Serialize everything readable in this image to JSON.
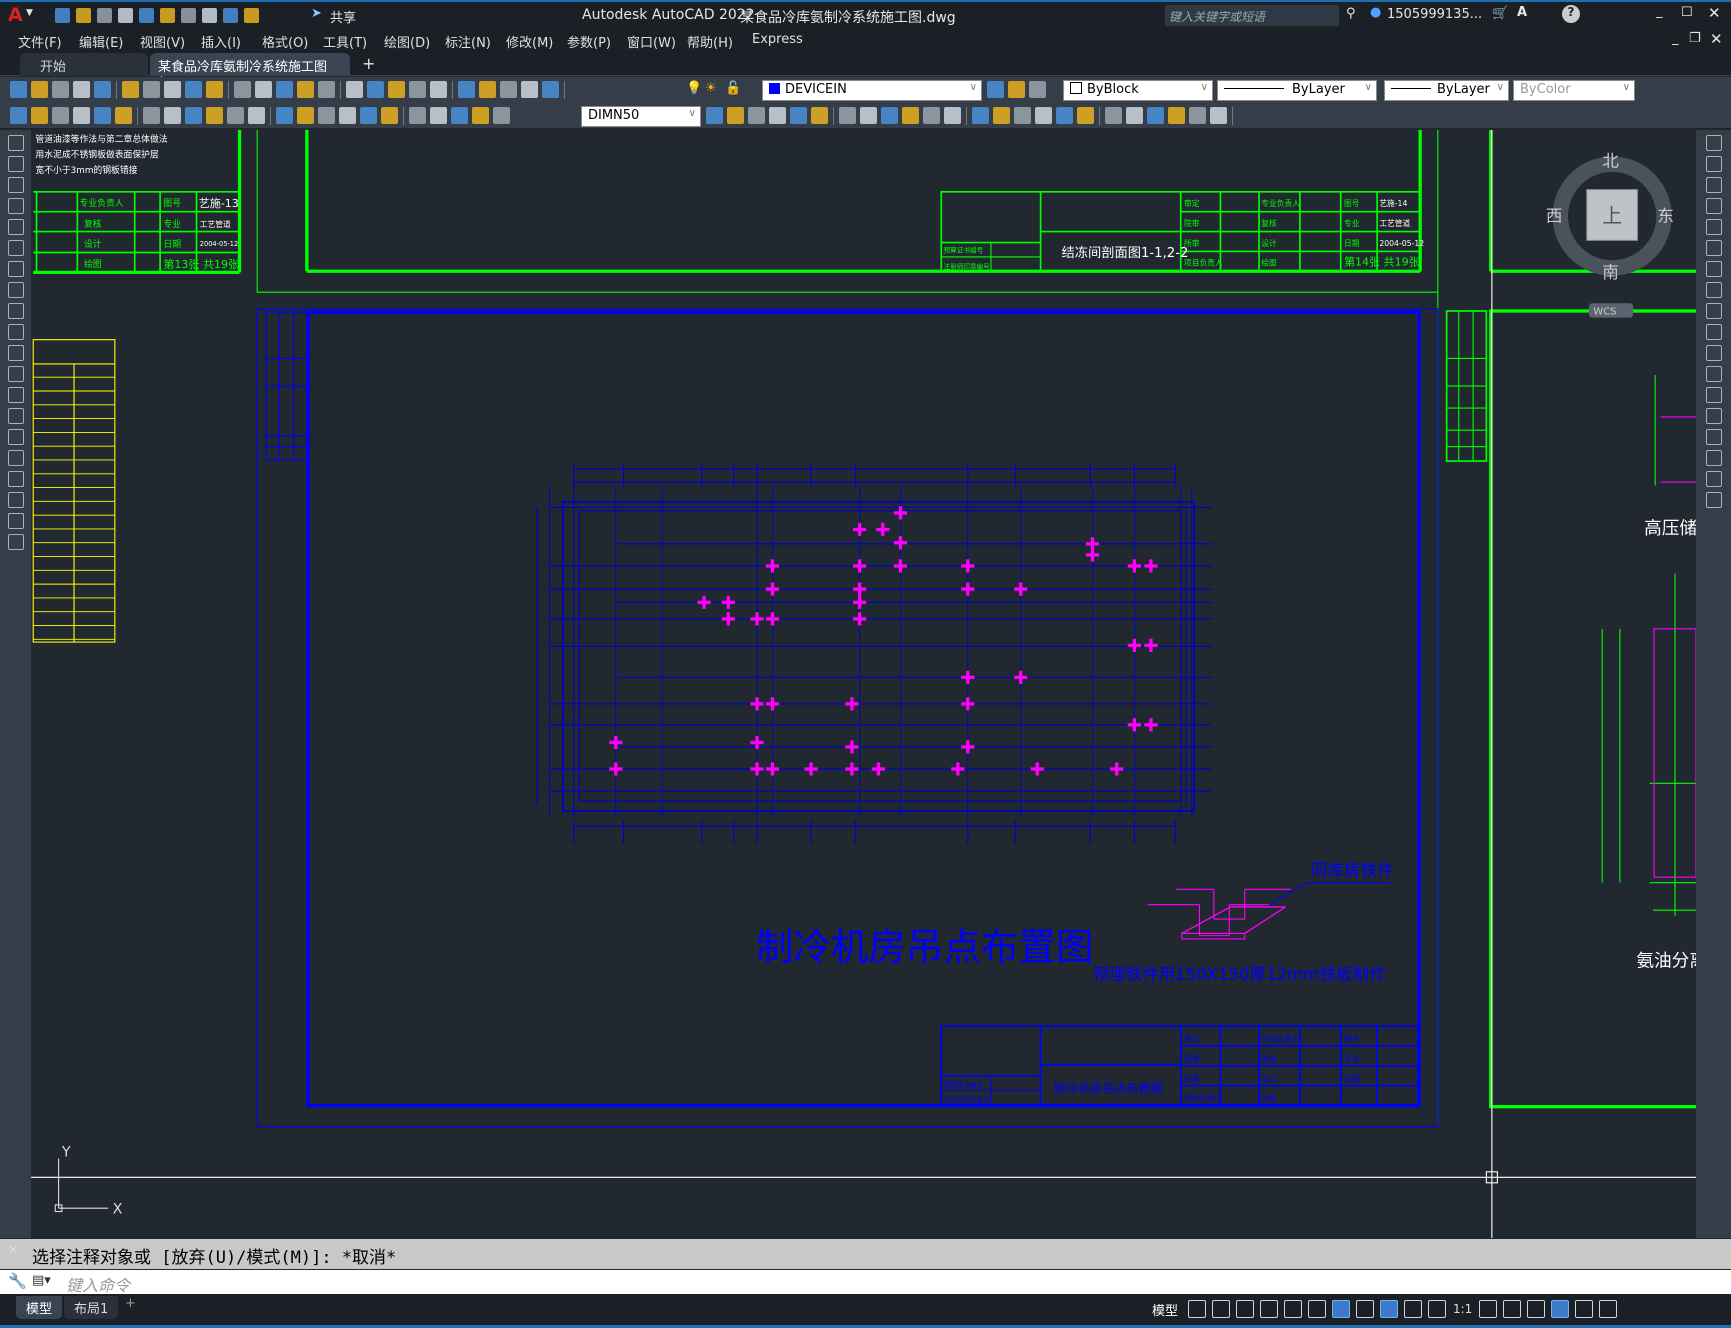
{
  "app": {
    "title": "Autodesk AutoCAD 2022",
    "file": "某食品冷库氨制冷系统施工图.dwg",
    "share": "共享",
    "search_placeholder": "键入关键字或短语",
    "user": "1505999135...",
    "logo": "A"
  },
  "menu": [
    "文件(F)",
    "编辑(E)",
    "视图(V)",
    "插入(I)",
    "格式(O)",
    "工具(T)",
    "绘图(D)",
    "标注(N)",
    "修改(M)",
    "参数(P)",
    "窗口(W)",
    "帮助(H)",
    "Express"
  ],
  "tabs": [
    {
      "label": "开始"
    },
    {
      "label": "某食品冷库氨制冷系统施工图*"
    }
  ],
  "toolbar1": {
    "icons": [
      "new-icon",
      "open-icon",
      "save-icon",
      "print-icon",
      "preview-icon",
      "plot-icon",
      "publish-icon",
      "cut-icon",
      "copy-icon",
      "paste-icon",
      "matchprop-icon",
      "block-icon",
      "undo-icon",
      "redo-icon",
      "pan-icon",
      "zoom-realtime-icon",
      "zoom-window-icon",
      "zoom-previous-icon",
      "properties-icon",
      "design-center-icon",
      "tool-palette-icon",
      "sheetset-icon",
      "markup-icon",
      "calculator-icon",
      "help-icon",
      "layer-icon"
    ],
    "layer": "DEVICEIN",
    "layer_color": "#0000ff",
    "color": "ByBlock",
    "linetype": "ByLayer",
    "lineweight": "ByLayer",
    "plotstyle": "ByColor"
  },
  "toolbar2": {
    "icons": [
      "edit-icon",
      "check-icon",
      "erase-icon",
      "linear-dim-icon",
      "aligned-dim-icon",
      "arc-length-icon",
      "ordinate-icon",
      "radius-icon",
      "jogged-icon",
      "diameter-icon",
      "angular-icon",
      "quick-dim-icon",
      "baseline-icon",
      "continue-icon",
      "space-icon",
      "break-icon",
      "tolerance-icon",
      "center-mark-icon",
      "inspect-icon",
      "jogged-linear-icon",
      "dimedit-icon",
      "dimtedit-icon",
      "update-icon"
    ],
    "dimstyle": "DIMN50",
    "icons2": [
      "dimstyle-icon",
      "modify-icon",
      "copy-obj-icon",
      "mirror-icon",
      "offset-icon",
      "array-icon",
      "move-icon",
      "rotate-icon",
      "scale-icon",
      "stretch-icon",
      "trim-icon",
      "extend-icon",
      "break-point-icon",
      "break-icon",
      "join-icon",
      "chamfer-icon",
      "fillet-icon",
      "blend-icon",
      "explode-icon",
      "insert-icon",
      "attach-icon",
      "clip-icon",
      "frame-icon",
      "refedit-icon"
    ]
  },
  "left_tools": [
    "line-icon",
    "construction-line-icon",
    "polyline-icon",
    "polygon-icon",
    "rectangle-icon",
    "arc-icon",
    "circle-icon",
    "revcloud-icon",
    "spline-icon",
    "ellipse-icon",
    "ellipse-arc-icon",
    "insert-block-icon",
    "make-block-icon",
    "point-icon",
    "hatch-icon",
    "gradient-icon",
    "region-icon",
    "table-icon",
    "mtext-icon",
    "add-selected-icon"
  ],
  "right_tools": [
    "erase-icon",
    "copy-icon",
    "mirror-icon",
    "offset-icon",
    "array-icon",
    "move-icon",
    "rotate-icon",
    "scale-icon",
    "stretch-icon",
    "trim-icon",
    "extend-icon",
    "break-point-icon",
    "break-icon",
    "join-icon",
    "chamfer-icon",
    "fillet-icon",
    "blend-icon",
    "explode-icon"
  ],
  "viewcube": {
    "north": "北",
    "south": "南",
    "east": "东",
    "west": "西",
    "top": "上",
    "wcs": "WCS"
  },
  "drawing": {
    "sheet13": {
      "notes": [
        "管道油漆等作法与第二章总体做法",
        "用水泥成不锈钢板做表面保护层",
        "宽不小于3mm的钢板错接"
      ],
      "rows": [
        [
          "专业负责人",
          "图号",
          "艺施-13"
        ],
        [
          "复核",
          "专业",
          "工艺管道"
        ],
        [
          "设计",
          "日期",
          "2004-05-12"
        ],
        [
          "绘图",
          "第13张 共19张",
          ""
        ]
      ]
    },
    "sheet14": {
      "title": "结冻间剖面图1-1,2-2",
      "left": [
        "预算证书编号",
        "注册师印章编号"
      ],
      "rows": [
        [
          "审定",
          "专业负责人",
          "图号",
          "艺施-14"
        ],
        [
          "院审",
          "复核",
          "专业",
          "工艺管道"
        ],
        [
          "所审",
          "设计",
          "日期",
          "2004-05-12"
        ],
        [
          "项目负责人",
          "绘图",
          "第14张 共19张",
          ""
        ]
      ]
    },
    "sheet_main": {
      "title": "制冷机房吊点布置图",
      "detail_label": "同库房铁件",
      "note": "预埋铁件用150X150厚12mm铁板制作",
      "block_title": "制冷机房吊点布置图",
      "left": [
        "预算证书编号",
        "注册师印章编号"
      ],
      "rows": [
        [
          "审定",
          "专业负责人",
          "图号"
        ],
        [
          "院审",
          "复核",
          "专业"
        ],
        [
          "所审",
          "设计",
          "日期"
        ],
        [
          "项目负责人",
          "绘图",
          ""
        ]
      ]
    },
    "right_labels": [
      "高压储",
      "氨油分离"
    ],
    "ucs": {
      "x": "X",
      "y": "Y"
    }
  },
  "command": {
    "history": "选择注释对象或 [放弃(U)/模式(M)]: *取消*",
    "placeholder": "键入命令"
  },
  "status": {
    "tabs": [
      "模型",
      "布局1"
    ],
    "model": "模型",
    "scale": "1:1",
    "icons": [
      "grid-icon",
      "snap-icon",
      "ortho-icon",
      "polar-icon",
      "isodraft-icon",
      "osnap-tracking-icon",
      "osnap-icon",
      "lineweight-icon",
      "annotation-visibility-icon",
      "autoscale-icon",
      "annotation-scale-icon",
      "workspace-icon",
      "plus-icon",
      "isolate-icon",
      "hardware-accel-icon",
      "fullscreen-icon",
      "customize-icon"
    ]
  },
  "colors": {
    "green": "#00ff00",
    "blue": "#0000ff",
    "magenta": "#ff00ff",
    "yellow": "#ffff00",
    "background": "#212830"
  }
}
